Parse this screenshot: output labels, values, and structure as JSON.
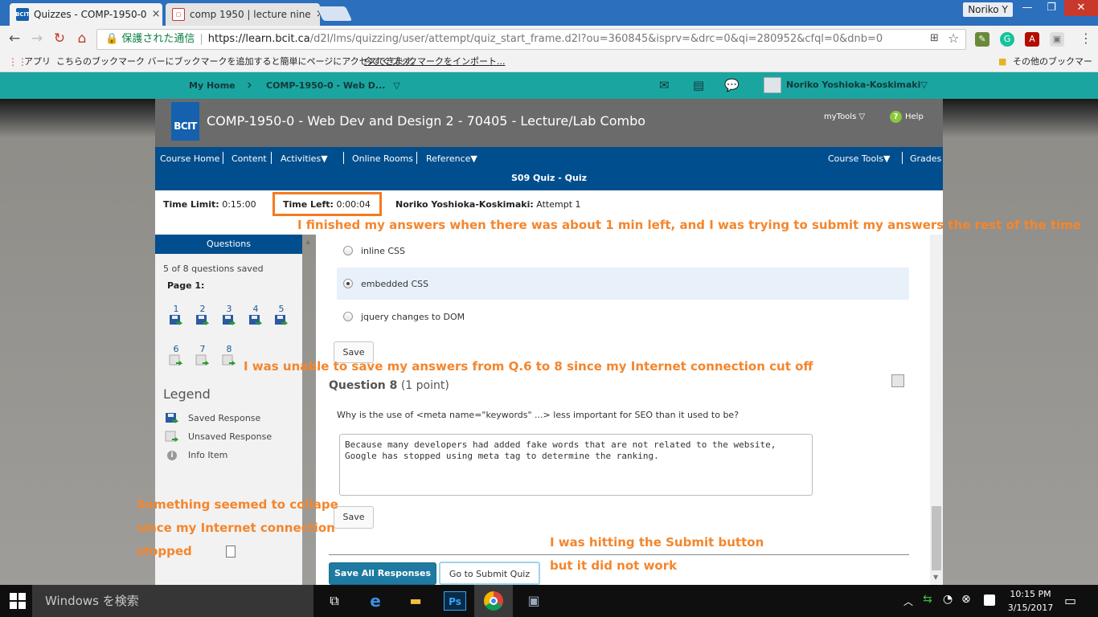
{
  "browser": {
    "tabs": [
      {
        "favicon": "BCIT",
        "title": "Quizzes - COMP-1950-0",
        "close": "×"
      },
      {
        "favicon": "doc",
        "title": "comp 1950 | lecture nine",
        "close": "×"
      }
    ],
    "profile_name": "Noriko Y",
    "window_controls": {
      "minimize": "—",
      "restore": "❐",
      "close": "✕"
    },
    "nav": {
      "back": "←",
      "forward": "→",
      "reload": "↻",
      "home": "⌂"
    },
    "omnibox": {
      "secure_label": "保護された通信",
      "url_host": "https://learn.bcit.ca",
      "url_path": "/d2l/lms/quizzing/user/attempt/quiz_start_frame.d2l?ou=360845&isprv=&drc=0&qi=280952&cfql=0&dnb=0"
    },
    "bookmarks_bar": {
      "apps": "アプリ",
      "message": "こちらのブックマーク バーにブックマークを追加すると簡単にページにアクセスできます。",
      "import_link": "今すぐブックマークをインポート...",
      "other": "その他のブックマーク"
    }
  },
  "lms": {
    "top": {
      "my_home": "My Home",
      "course_crumb": "COMP-1950-0 - Web D...",
      "user_name": "Noriko Yoshioka-Koskimaki"
    },
    "course": {
      "logo": "BCIT",
      "title": "COMP-1950-0 - Web Dev and Design 2 - 70405 - Lecture/Lab Combo",
      "mytools": "myTools",
      "help": "Help"
    },
    "nav": {
      "course_home": "Course Home",
      "content": "Content",
      "activities": "Activities",
      "online_rooms": "Online Rooms",
      "reference": "Reference",
      "course_tools": "Course Tools",
      "grades": "Grades"
    },
    "quiz_title": "S09 Quiz - Quiz",
    "info": {
      "time_limit_label": "Time Limit:",
      "time_limit": "0:15:00",
      "time_left_label": "Time Left:",
      "time_left": "0:00:04",
      "attempt_user": "Noriko Yoshioka-Koskimaki:",
      "attempt": "Attempt 1"
    },
    "sidebar": {
      "header": "Questions",
      "saved_status": "5 of 8 questions saved",
      "page_label": "Page 1:",
      "questions": [
        {
          "num": "1",
          "state": "saved"
        },
        {
          "num": "2",
          "state": "saved"
        },
        {
          "num": "3",
          "state": "saved"
        },
        {
          "num": "4",
          "state": "saved"
        },
        {
          "num": "5",
          "state": "saved"
        },
        {
          "num": "6",
          "state": "unsaved"
        },
        {
          "num": "7",
          "state": "unsaved"
        },
        {
          "num": "8",
          "state": "unsaved"
        }
      ],
      "legend_title": "Legend",
      "legend": [
        {
          "label": "Saved Response"
        },
        {
          "label": "Unsaved Response"
        },
        {
          "label": "Info Item"
        }
      ]
    },
    "q7": {
      "options": [
        {
          "label": "inline CSS",
          "selected": false
        },
        {
          "label": "embedded CSS",
          "selected": true
        },
        {
          "label": "jquery changes to DOM",
          "selected": false
        }
      ],
      "save": "Save"
    },
    "q8": {
      "title": "Question 8",
      "points": "(1 point)",
      "prompt": "Why is the use of <meta name=\"keywords\" ...> less important for SEO than it used to be?",
      "answer": "Because many developers had added fake words that are not related to the website, Google has stopped using meta tag to determine the ranking.",
      "save": "Save"
    },
    "footer": {
      "save_all": "Save All Responses",
      "submit": "Go to Submit Quiz"
    }
  },
  "annotations": {
    "a1": "I finished my answers when there was about 1 min left, and I was trying to submit my answers the rest of the time",
    "a2": "I was unable to save my answers from Q.6 to 8 since my Internet connection cut off",
    "a3_l1": "Something seemed to collape",
    "a3_l2": "since my Internet connection",
    "a3_l3": "stopped",
    "a4_l1": "I was hitting the Submit button",
    "a4_l2": "but it did not work"
  },
  "taskbar": {
    "search_placeholder": "Windows を検索",
    "time": "10:15 PM",
    "date": "3/15/2017"
  },
  "colors": {
    "teal": "#1aa5a0",
    "navy": "#004e8d",
    "annotation": "#f4862d",
    "accent_button": "#1e7aa0"
  }
}
